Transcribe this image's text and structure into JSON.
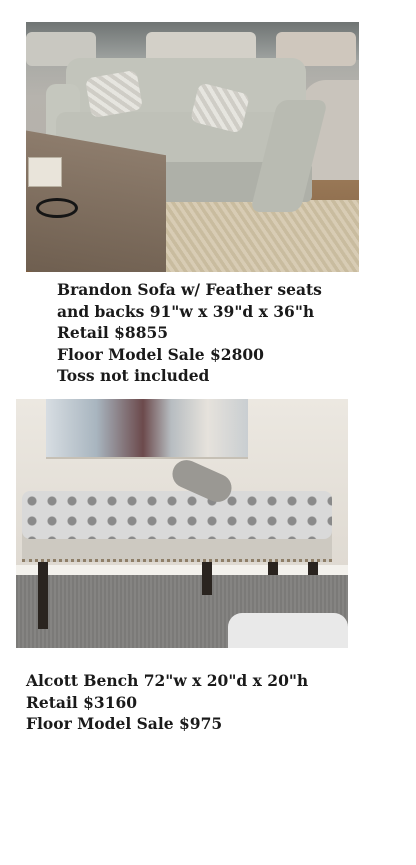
{
  "products": [
    {
      "photo_icon": "sofa-photo",
      "lines": [
        "Brandon Sofa w/ Feather seats",
        "and backs 91\"w x 39\"d x 36\"h",
        "Retail $8855",
        "Floor Model Sale $2800",
        "Toss not included"
      ]
    },
    {
      "photo_icon": "bench-photo",
      "lines": [
        "Alcott Bench 72\"w x 20\"d x 20\"h",
        "Retail $3160",
        "Floor Model Sale $975"
      ]
    }
  ]
}
